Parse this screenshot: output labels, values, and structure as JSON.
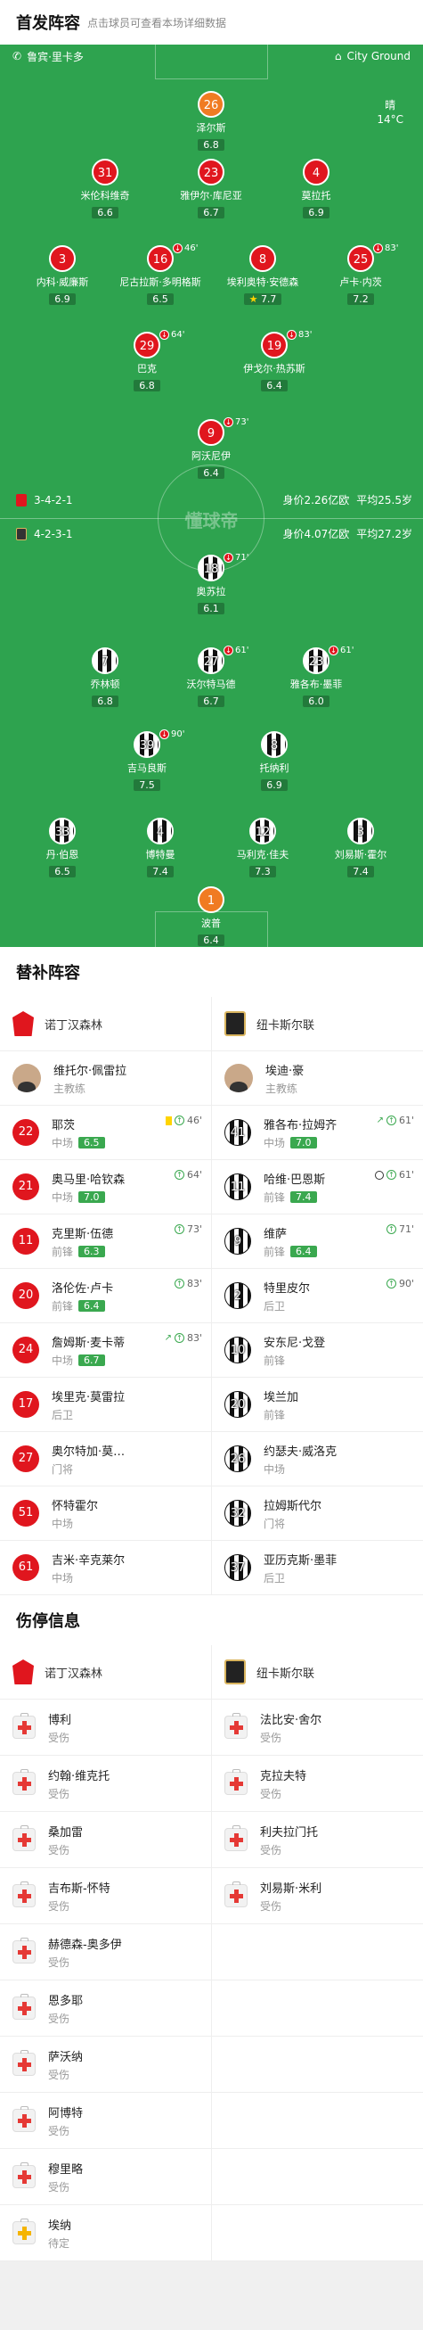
{
  "header": {
    "title": "首发阵容",
    "subtitle": "点击球员可查看本场详细数据"
  },
  "pitch_bar": {
    "referee": "鲁宾·里卡多",
    "venue": "City Ground"
  },
  "weather": {
    "condition": "晴",
    "temp": "14°C"
  },
  "watermark": "懂球帝",
  "home_info": {
    "formation": "3-4-2-1",
    "value": "身价2.26亿欧",
    "age": "平均25.5岁"
  },
  "away_info": {
    "formation": "4-2-3-1",
    "value": "身价4.07亿欧",
    "age": "平均27.2岁"
  },
  "home_players": [
    {
      "num": "26",
      "name": "泽尔斯",
      "rating": "6.8",
      "gk": true
    },
    {
      "num": "31",
      "name": "米伦科维奇",
      "rating": "6.6"
    },
    {
      "num": "23",
      "name": "雅伊尔·库尼亚",
      "rating": "6.7"
    },
    {
      "num": "4",
      "name": "莫拉托",
      "rating": "6.9"
    },
    {
      "num": "3",
      "name": "内科·威廉斯",
      "rating": "6.9"
    },
    {
      "num": "16",
      "name": "尼古拉斯·多明格斯",
      "rating": "6.5",
      "sub": "46'"
    },
    {
      "num": "8",
      "name": "埃利奥特·安德森",
      "rating": "7.7",
      "sub": ""
    },
    {
      "num": "25",
      "name": "卢卡·内茨",
      "rating": "7.2",
      "sub": "83'"
    },
    {
      "num": "29",
      "name": "巴克",
      "rating": "6.8",
      "sub": "64'"
    },
    {
      "num": "19",
      "name": "伊戈尔·热苏斯",
      "rating": "6.4",
      "sub": "83'"
    },
    {
      "num": "9",
      "name": "阿沃尼伊",
      "rating": "6.4",
      "sub": "73'"
    }
  ],
  "away_players": [
    {
      "num": "18",
      "name": "奥苏拉",
      "rating": "6.1",
      "sub": "71'"
    },
    {
      "num": "7",
      "name": "乔林顿",
      "rating": "6.8"
    },
    {
      "num": "27",
      "name": "沃尔特马德",
      "rating": "6.7",
      "sub": "61'"
    },
    {
      "num": "23",
      "name": "雅各布·墨菲",
      "rating": "6.0",
      "sub": "61'"
    },
    {
      "num": "39",
      "name": "吉马良斯",
      "rating": "7.5",
      "sub": "90'"
    },
    {
      "num": "8",
      "name": "托纳利",
      "rating": "6.9"
    },
    {
      "num": "33",
      "name": "丹·伯恩",
      "rating": "6.5"
    },
    {
      "num": "4",
      "name": "博特曼",
      "rating": "7.4"
    },
    {
      "num": "12",
      "name": "马利克·佳夫",
      "rating": "7.3"
    },
    {
      "num": "3",
      "name": "刘易斯·霍尔",
      "rating": "7.4"
    },
    {
      "num": "1",
      "name": "波普",
      "rating": "6.4",
      "gk": true
    }
  ],
  "subs": {
    "title": "替补阵容",
    "home_team": "诺丁汉森林",
    "away_team": "纽卡斯尔联",
    "home_coach": {
      "name": "维托尔·佩雷拉",
      "role": "主教练"
    },
    "away_coach": {
      "name": "埃迪·豪",
      "role": "主教练"
    },
    "rows": [
      {
        "home": {
          "num": "22",
          "name": "耶茨",
          "pos": "中场",
          "rating": "6.5",
          "evt": "46'"
        },
        "away": {
          "num": "41",
          "name": "雅各布·拉姆齐",
          "pos": "中场",
          "rating": "7.0",
          "evt": "61'"
        }
      },
      {
        "home": {
          "num": "21",
          "name": "奥马里·哈钦森",
          "pos": "中场",
          "rating": "7.0",
          "evt": "64'"
        },
        "away": {
          "num": "11",
          "name": "哈维·巴恩斯",
          "pos": "前锋",
          "rating": "7.4",
          "evt": "61'"
        }
      },
      {
        "home": {
          "num": "11",
          "name": "克里斯·伍德",
          "pos": "前锋",
          "rating": "6.3",
          "evt": "73'"
        },
        "away": {
          "num": "9",
          "name": "维萨",
          "pos": "前锋",
          "rating": "6.4",
          "evt": "71'"
        }
      },
      {
        "home": {
          "num": "20",
          "name": "洛伦佐·卢卡",
          "pos": "前锋",
          "rating": "6.4",
          "evt": "83'"
        },
        "away": {
          "num": "2",
          "name": "特里皮尔",
          "pos": "后卫",
          "rating": "",
          "evt": "90'"
        }
      },
      {
        "home": {
          "num": "24",
          "name": "詹姆斯·麦卡蒂",
          "pos": "中场",
          "rating": "6.7",
          "evt": "83'"
        },
        "away": {
          "num": "10",
          "name": "安东尼·戈登",
          "pos": "前锋",
          "rating": "",
          "evt": ""
        }
      },
      {
        "home": {
          "num": "17",
          "name": "埃里克·莫雷拉",
          "pos": "后卫",
          "rating": "",
          "evt": ""
        },
        "away": {
          "num": "20",
          "name": "埃兰加",
          "pos": "前锋",
          "rating": "",
          "evt": ""
        }
      },
      {
        "home": {
          "num": "27",
          "name": "奥尔特加·莫…",
          "pos": "门将",
          "rating": "",
          "evt": ""
        },
        "away": {
          "num": "26",
          "name": "约瑟夫·威洛克",
          "pos": "中场",
          "rating": "",
          "evt": ""
        }
      },
      {
        "home": {
          "num": "51",
          "name": "怀特霍尔",
          "pos": "中场",
          "rating": "",
          "evt": ""
        },
        "away": {
          "num": "32",
          "name": "拉姆斯代尔",
          "pos": "门将",
          "rating": "",
          "evt": ""
        }
      },
      {
        "home": {
          "num": "61",
          "name": "吉米·辛克莱尔",
          "pos": "中场",
          "rating": "",
          "evt": ""
        },
        "away": {
          "num": "37",
          "name": "亚历克斯·墨菲",
          "pos": "后卫",
          "rating": "",
          "evt": ""
        }
      }
    ]
  },
  "injuries": {
    "title": "伤停信息",
    "home_team": "诺丁汉森林",
    "away_team": "纽卡斯尔联",
    "home": [
      {
        "name": "博利",
        "status": "受伤"
      },
      {
        "name": "约翰·维克托",
        "status": "受伤"
      },
      {
        "name": "桑加雷",
        "status": "受伤"
      },
      {
        "name": "吉布斯-怀特",
        "status": "受伤"
      },
      {
        "name": "赫德森-奥多伊",
        "status": "受伤"
      },
      {
        "name": "恩多耶",
        "status": "受伤"
      },
      {
        "name": "萨沃纳",
        "status": "受伤"
      },
      {
        "name": "阿博特",
        "status": "受伤"
      },
      {
        "name": "穆里略",
        "status": "受伤"
      },
      {
        "name": "埃纳",
        "status": "待定"
      }
    ],
    "away": [
      {
        "name": "法比安·舍尔",
        "status": "受伤"
      },
      {
        "name": "克拉夫特",
        "status": "受伤"
      },
      {
        "name": "利夫拉门托",
        "status": "受伤"
      },
      {
        "name": "刘易斯·米利",
        "status": "受伤"
      }
    ]
  },
  "colors": {
    "pitch": "#2ea34f",
    "home": "#e0161e",
    "gk": "#f07b22",
    "rating_green": "#3aa84f"
  }
}
